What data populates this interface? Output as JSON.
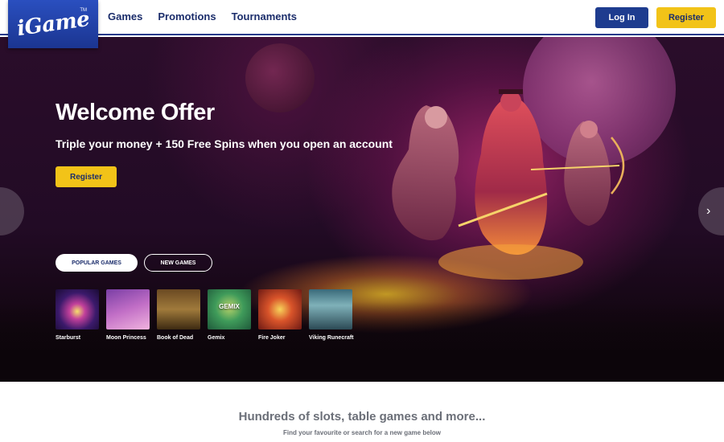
{
  "header": {
    "logo": "iGame",
    "logo_tm": "TM",
    "nav": [
      "Games",
      "Promotions",
      "Tournaments"
    ],
    "login_label": "Log In",
    "register_label": "Register"
  },
  "hero": {
    "title": "Welcome Offer",
    "subtitle": "Triple your money + 150 Free Spins when you open an account",
    "cta_label": "Register",
    "tabs": [
      "POPULAR GAMES",
      "NEW GAMES"
    ],
    "games": [
      {
        "name": "Starburst",
        "thumb_text": ""
      },
      {
        "name": "Moon Princess",
        "thumb_text": ""
      },
      {
        "name": "Book of Dead",
        "thumb_text": ""
      },
      {
        "name": "Gemix",
        "thumb_text": "GEMIX"
      },
      {
        "name": "Fire Joker",
        "thumb_text": ""
      },
      {
        "name": "Viking Runecraft",
        "thumb_text": ""
      }
    ]
  },
  "section": {
    "title": "Hundreds of slots, table games and more...",
    "subtitle": "Find your favourite or search for a new game below"
  },
  "colors": {
    "brand_blue": "#1e3c8f",
    "accent_yellow": "#f2c318",
    "hero_bg": "#220b25"
  },
  "icons": {
    "carousel_prev": "chevron-left-icon",
    "carousel_next": "chevron-right-icon"
  }
}
